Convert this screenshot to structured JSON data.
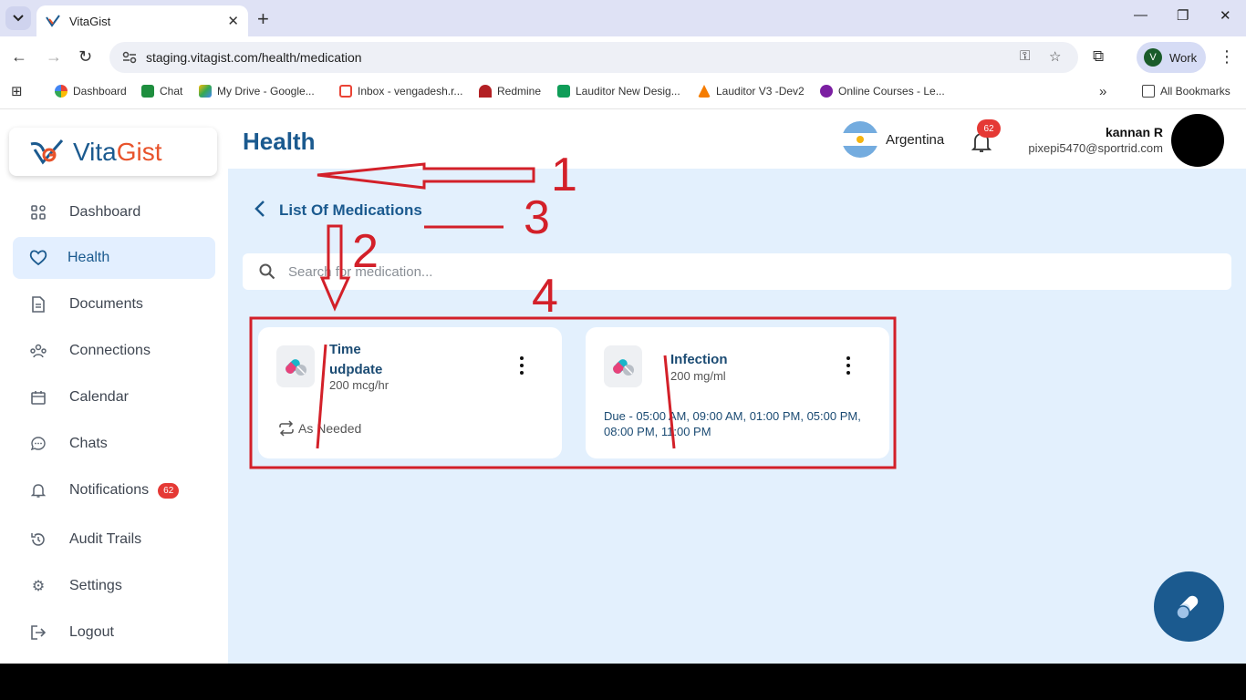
{
  "browser": {
    "tab_title": "VitaGist",
    "url": "staging.vitagist.com/health/medication",
    "profile_initial": "V",
    "profile_label": "Work",
    "bookmarks": [
      {
        "label": "Dashboard"
      },
      {
        "label": "Chat"
      },
      {
        "label": "My Drive - Google..."
      },
      {
        "label": "Inbox - vengadesh.r..."
      },
      {
        "label": "Redmine"
      },
      {
        "label": "Lauditor New Desig..."
      },
      {
        "label": "Lauditor V3 -Dev2"
      },
      {
        "label": "Online Courses - Le..."
      }
    ],
    "all_bookmarks": "All Bookmarks",
    "more_bookmarks": "»"
  },
  "logo": {
    "part1": "Vita",
    "part2": "Gist"
  },
  "sidebar": {
    "items": [
      {
        "label": "Dashboard",
        "icon": "grid-icon"
      },
      {
        "label": "Health",
        "icon": "heart-icon"
      },
      {
        "label": "Documents",
        "icon": "document-icon"
      },
      {
        "label": "Connections",
        "icon": "people-icon"
      },
      {
        "label": "Calendar",
        "icon": "calendar-icon"
      },
      {
        "label": "Chats",
        "icon": "chat-icon"
      },
      {
        "label": "Notifications",
        "icon": "bell-icon",
        "badge": "62"
      },
      {
        "label": "Audit Trails",
        "icon": "history-icon"
      },
      {
        "label": "Settings",
        "icon": "gear-icon"
      },
      {
        "label": "Logout",
        "icon": "logout-icon"
      }
    ]
  },
  "header": {
    "title": "Health",
    "country": "Argentina",
    "notification_count": "62",
    "user_name": "kannan R",
    "user_email": "pixepi5470@sportrid.com"
  },
  "content": {
    "list_title": "List Of Medications",
    "search_placeholder": "Search for medication..."
  },
  "medications": [
    {
      "name": "Time udpdate",
      "dose": "200 mcg/hr",
      "schedule": "As Needed"
    },
    {
      "name": "Infection",
      "dose": "200 mg/ml",
      "schedule": "Due - 05:00 AM, 09:00 AM, 01:00 PM, 05:00 PM, 08:00 PM, 11:00 PM"
    }
  ],
  "annotations": {
    "n1": "1",
    "n2": "2",
    "n3": "3",
    "n4": "4"
  },
  "colors": {
    "brand": "#1b5a8f",
    "accent": "#e8532b",
    "badge": "#e53935",
    "annotation": "#d32029",
    "main_bg": "#e3f0fd"
  }
}
